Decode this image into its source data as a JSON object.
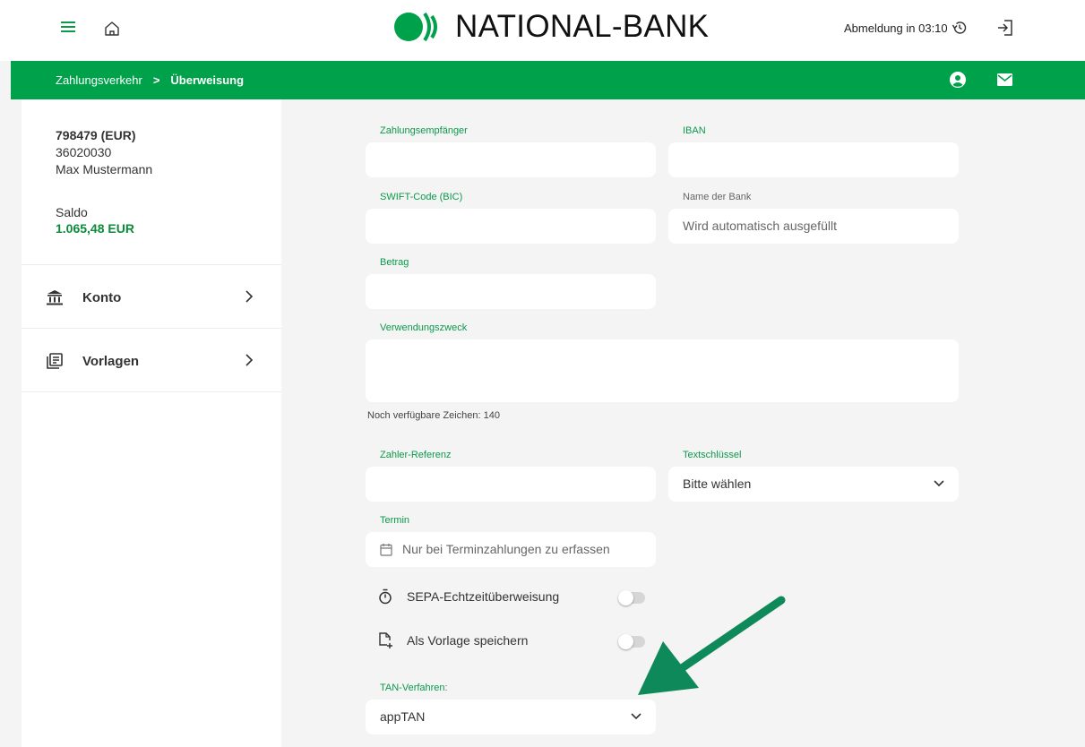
{
  "header": {
    "logo_text": "NATIONAL-BANK",
    "logout_timer_label": "Abmeldung in 03:10",
    "icons": [
      "menu-icon",
      "home-icon",
      "history-icon",
      "logout-icon"
    ]
  },
  "breadcrumb": {
    "parent": "Zahlungsverkehr",
    "separator": ">",
    "current": "Überweisung",
    "icons": [
      "user-icon",
      "mail-icon"
    ]
  },
  "sidebar": {
    "account_number": "798479 (EUR)",
    "bank_code": "36020030",
    "holder": "Max Mustermann",
    "saldo_label": "Saldo",
    "saldo_value": "1.065,48 EUR",
    "items": [
      {
        "label": "Konto",
        "icon": "bank-icon"
      },
      {
        "label": "Vorlagen",
        "icon": "templates-icon"
      }
    ]
  },
  "form": {
    "recipient_label": "Zahlungsempfänger",
    "recipient_value": "",
    "iban_label": "IBAN",
    "iban_value": "",
    "bic_label": "SWIFT-Code (BIC)",
    "bic_value": "",
    "bank_name_label": "Name der Bank",
    "bank_name_placeholder": "Wird automatisch ausgefüllt",
    "amount_label": "Betrag",
    "amount_value": "",
    "purpose_label": "Verwendungszweck",
    "purpose_value": "",
    "chars_left": "Noch verfügbare Zeichen: 140",
    "payer_ref_label": "Zahler-Referenz",
    "payer_ref_value": "",
    "text_key_label": "Textschlüssel",
    "text_key_value": "Bitte wählen",
    "date_label": "Termin",
    "date_placeholder": "Nur bei Terminzahlungen zu erfassen",
    "instant_label": "SEPA-Echtzeitüberweisung",
    "instant_on": false,
    "save_template_label": "Als Vorlage speichern",
    "save_template_on": false,
    "tan_label": "TAN-Verfahren:",
    "tan_value": "appTAN"
  },
  "colors": {
    "brand_green": "#00a14b",
    "label_green": "#0a9a4a",
    "arrow_green": "#0e8a5a",
    "background": "#f4f4f4"
  }
}
